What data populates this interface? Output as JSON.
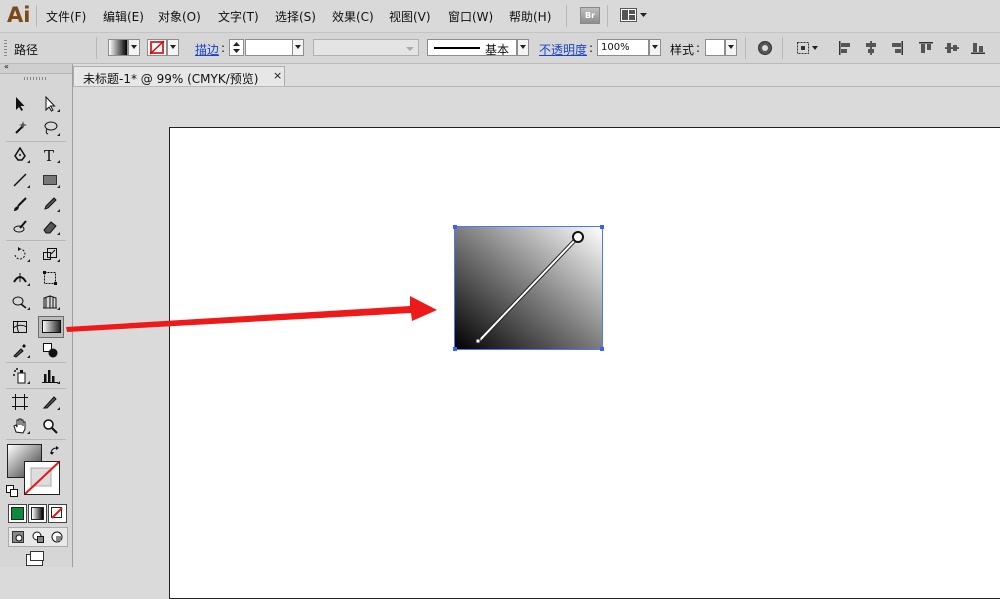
{
  "app": {
    "logo": "Ai"
  },
  "menu": {
    "items": [
      "文件(F)",
      "编辑(E)",
      "对象(O)",
      "文字(T)",
      "选择(S)",
      "效果(C)",
      "视图(V)",
      "窗口(W)",
      "帮助(H)"
    ],
    "bridge_label": "Br"
  },
  "control_bar": {
    "selection_type": "路径",
    "stroke_label": "描边",
    "stroke_style_label": "基本",
    "opacity_label": "不透明度",
    "opacity_value": "100%",
    "style_label": "样式"
  },
  "document": {
    "tab_title": "未标题-1* @ 99% (CMYK/预览)",
    "tab_close": "×"
  },
  "tools": {
    "active": "gradient-tool",
    "fill_icon": "gradient-fill-swatch",
    "stroke_icon": "none-stroke-swatch"
  },
  "colors": {
    "accent": "#1a44c8",
    "arrow": "#ee1a1a",
    "selection": "#3a5fff",
    "fill_mode_color": "#0a8a3a"
  }
}
